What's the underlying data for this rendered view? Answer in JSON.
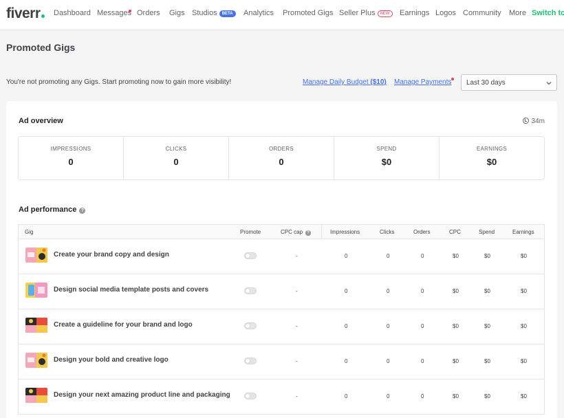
{
  "nav": {
    "logo": "fiverr",
    "items": [
      {
        "label": "Dashboard"
      },
      {
        "label": "Messages"
      },
      {
        "label": "Orders"
      },
      {
        "label": "Gigs"
      },
      {
        "label": "Studios",
        "badge": "BETA"
      },
      {
        "label": "Analytics"
      },
      {
        "label": "Promoted Gigs"
      },
      {
        "label": "Seller Plus",
        "badge": "NEW"
      },
      {
        "label": "Earnings"
      },
      {
        "label": "Logos"
      },
      {
        "label": "Community"
      },
      {
        "label": "More"
      }
    ],
    "switch_label": "Switch to"
  },
  "header": {
    "title": "Promoted Gigs",
    "notice": "You're not promoting any Gigs. Start promoting now to gain more visibility!",
    "budget_link": "Manage Daily Budget",
    "budget_amount": "($10)",
    "payments_link": "Manage Payments",
    "date_range": "Last 30 days"
  },
  "overview": {
    "title": "Ad overview",
    "updated": "34m",
    "stats": [
      {
        "label": "IMPRESSIONS",
        "value": "0"
      },
      {
        "label": "CLICKS",
        "value": "0"
      },
      {
        "label": "ORDERS",
        "value": "0"
      },
      {
        "label": "SPEND",
        "value": "$0"
      },
      {
        "label": "EARNINGS",
        "value": "$0"
      }
    ]
  },
  "performance": {
    "title": "Ad performance",
    "info_icon": "?",
    "columns": {
      "gig": "Gig",
      "promote": "Promote",
      "cpc_cap": "CPC cap",
      "impressions": "Impressions",
      "clicks": "Clicks",
      "orders": "Orders",
      "cpc": "CPC",
      "spend": "Spend",
      "earnings": "Earnings"
    },
    "rows": [
      {
        "title": "Create your brand copy and design",
        "promote": false,
        "cpc_cap": "-",
        "impressions": "0",
        "clicks": "0",
        "orders": "0",
        "cpc": "$0",
        "spend": "$0",
        "earnings": "$0"
      },
      {
        "title": "Design social media template posts and covers",
        "promote": false,
        "cpc_cap": "-",
        "impressions": "0",
        "clicks": "0",
        "orders": "0",
        "cpc": "$0",
        "spend": "$0",
        "earnings": "$0"
      },
      {
        "title": "Create a guideline for your brand and logo",
        "promote": false,
        "cpc_cap": "-",
        "impressions": "0",
        "clicks": "0",
        "orders": "0",
        "cpc": "$0",
        "spend": "$0",
        "earnings": "$0"
      },
      {
        "title": "Design your bold and creative logo",
        "promote": false,
        "cpc_cap": "-",
        "impressions": "0",
        "clicks": "0",
        "orders": "0",
        "cpc": "$0",
        "spend": "$0",
        "earnings": "$0"
      },
      {
        "title": "Design your next amazing product line and packaging",
        "promote": false,
        "cpc_cap": "-",
        "impressions": "0",
        "clicks": "0",
        "orders": "0",
        "cpc": "$0",
        "spend": "$0",
        "earnings": "$0"
      }
    ]
  },
  "colors": {
    "brand_green": "#1dbf73",
    "link_blue": "#446ee7",
    "notify_red": "#e0435b"
  }
}
